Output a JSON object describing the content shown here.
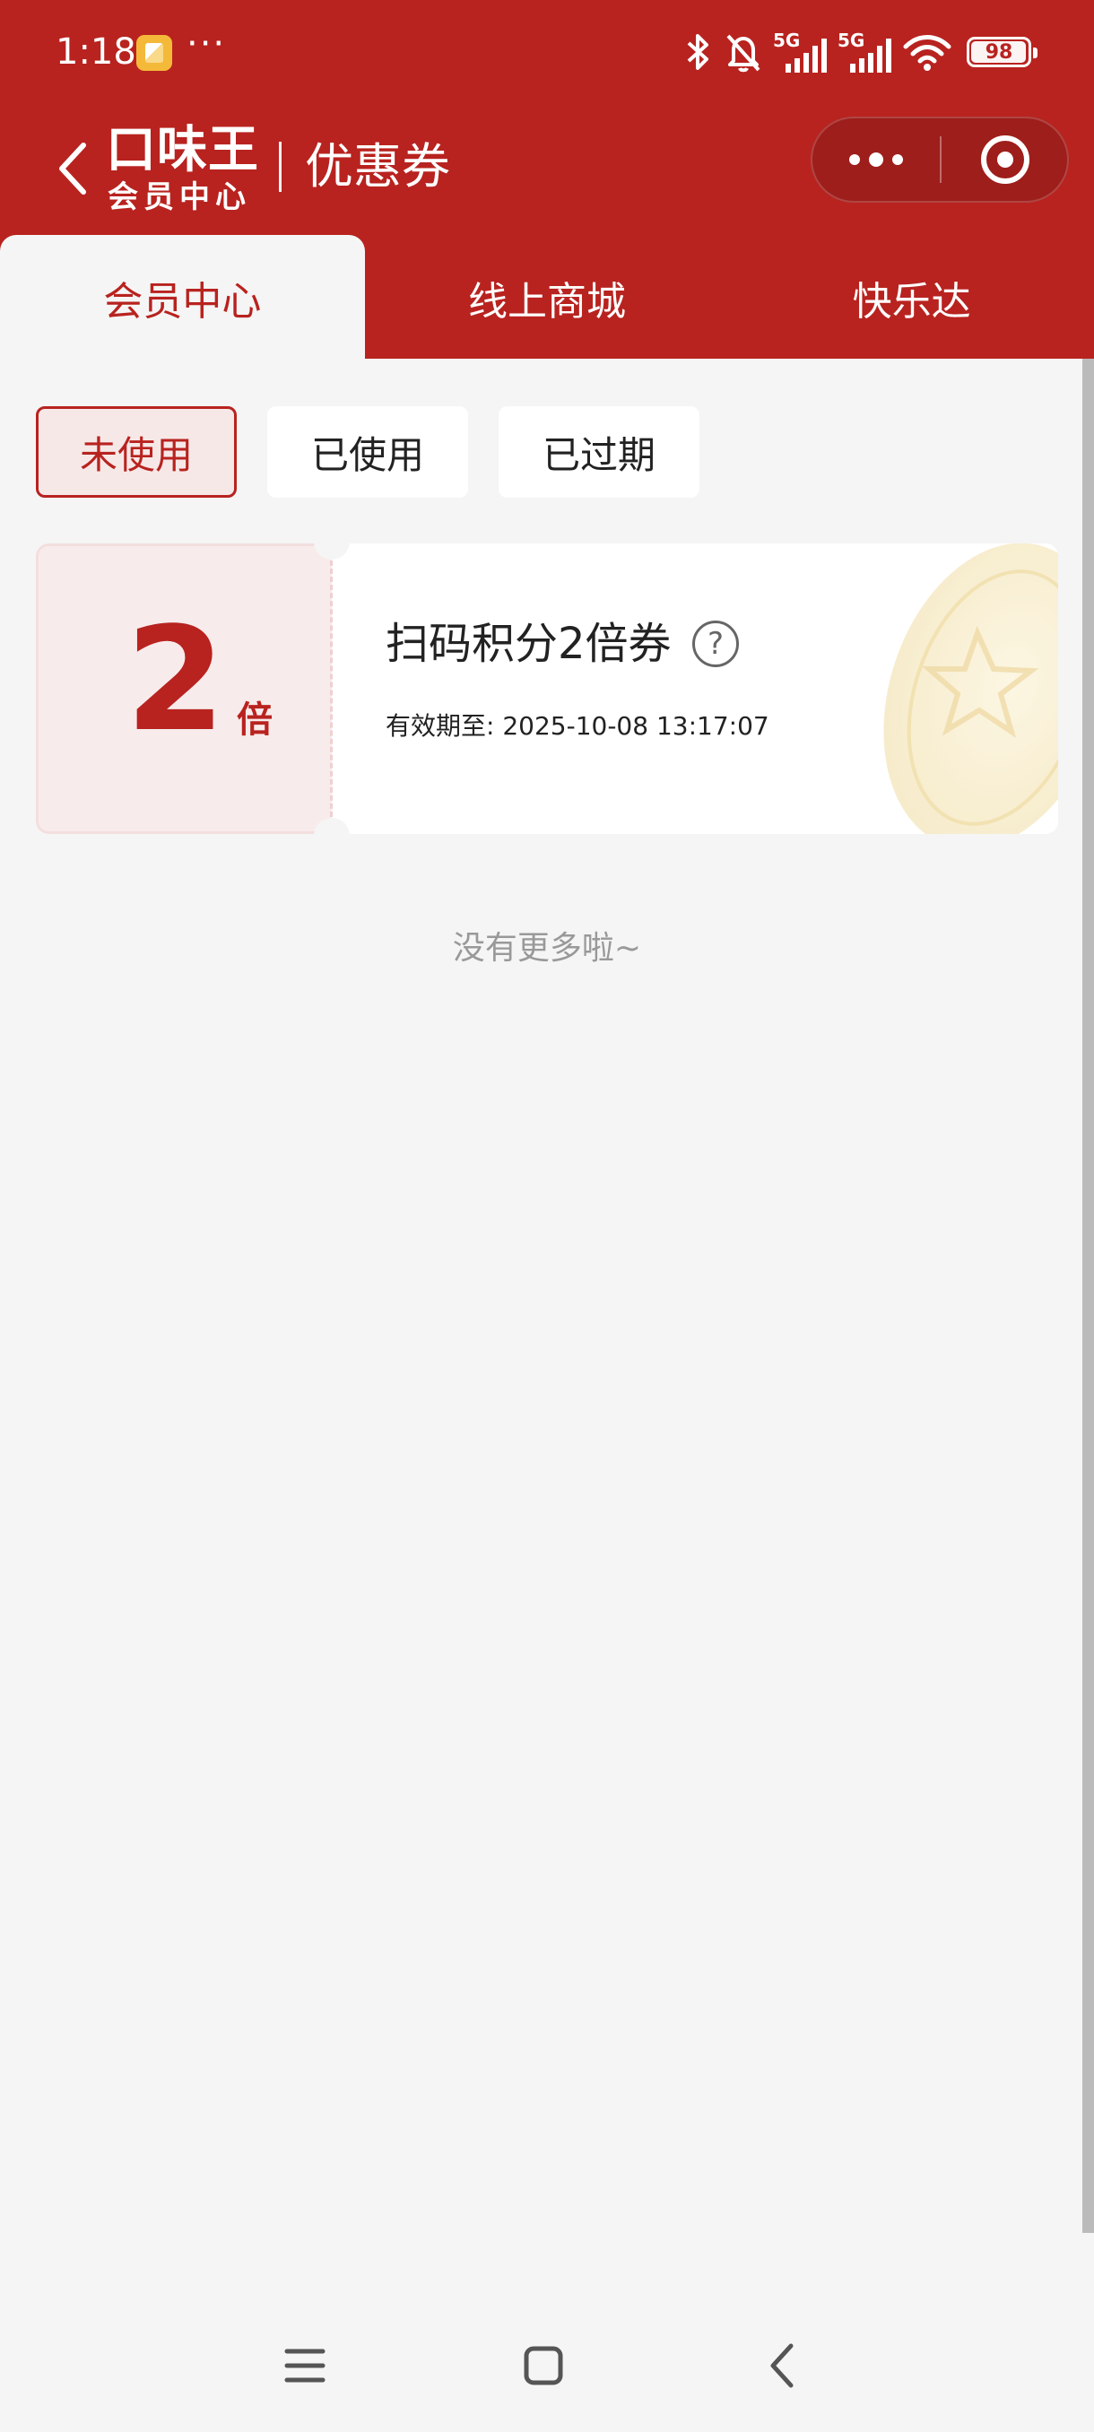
{
  "status_bar": {
    "time": "1:18",
    "more": "···",
    "network_1": "5G",
    "network_2": "5G",
    "battery": "98"
  },
  "header": {
    "logo_main": "口味王",
    "logo_sub": "会员中心",
    "page_title": "优惠券"
  },
  "tabs": [
    {
      "label": "会员中心",
      "active": true
    },
    {
      "label": "线上商城",
      "active": false
    },
    {
      "label": "快乐达",
      "active": false
    }
  ],
  "filters": [
    {
      "label": "未使用",
      "active": true
    },
    {
      "label": "已使用",
      "active": false
    },
    {
      "label": "已过期",
      "active": false
    }
  ],
  "coupon": {
    "value": "2",
    "unit": "倍",
    "title": "扫码积分2倍券",
    "help": "?",
    "expiry": "有效期至: 2025-10-08 13:17:07"
  },
  "list_footer": "没有更多啦~",
  "colors": {
    "brand_red": "#b8231f",
    "background": "#f5f5f5",
    "coupon_left_bg": "#f8ebeb"
  },
  "icons": {
    "back": "chevron-left-icon",
    "menu_more": "more-dots-icon",
    "close_mini": "target-ring-icon",
    "nav_menu": "hamburger-icon",
    "nav_home": "square-icon",
    "nav_back": "chevron-left-icon"
  }
}
